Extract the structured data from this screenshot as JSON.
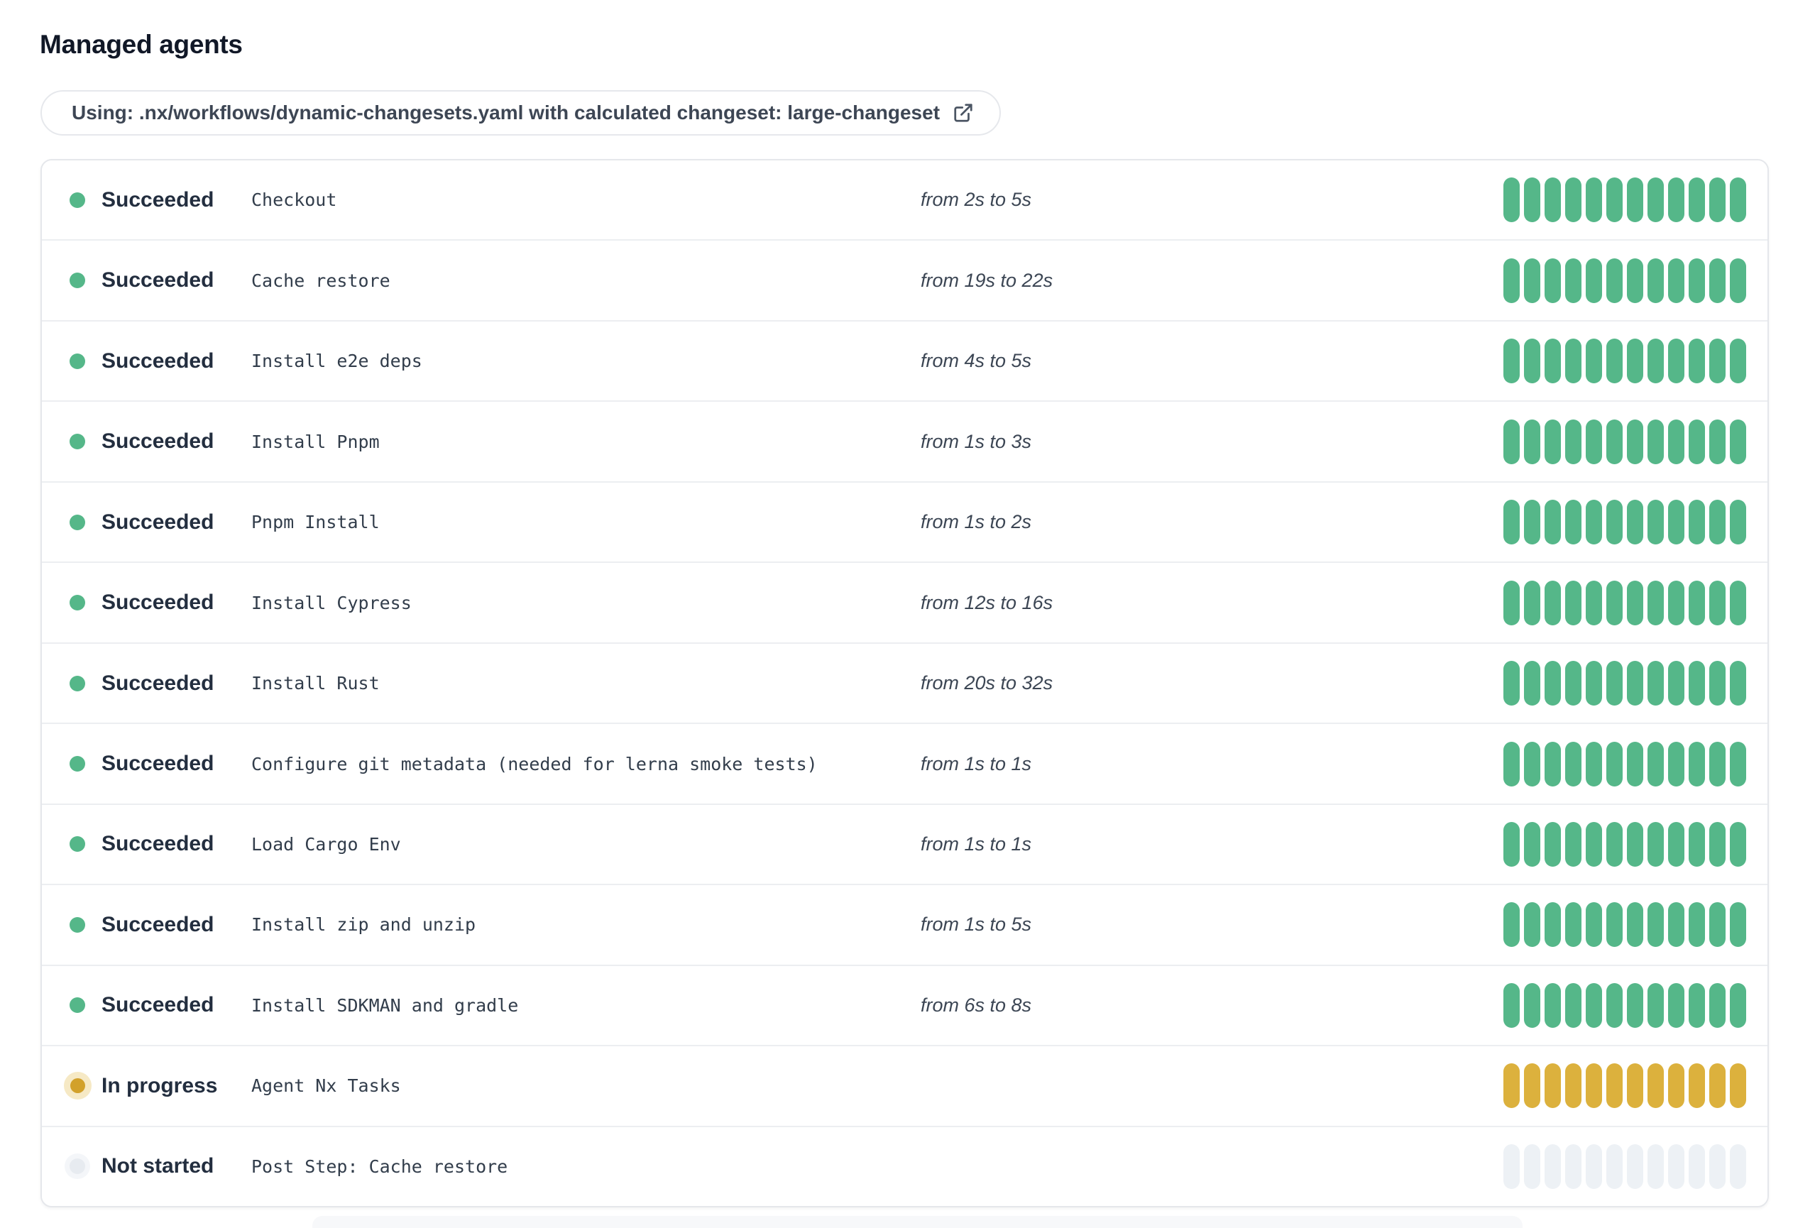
{
  "page": {
    "title": "Managed agents"
  },
  "banner": {
    "label": "Using: .nx/workflows/dynamic-changesets.yaml with calculated changeset: large-changeset",
    "icon": "external-link-icon"
  },
  "bar": {
    "segments_per_row": 12
  },
  "colors": {
    "succeeded_segment": "#55b789",
    "in_progress_segment": "#dcb13d",
    "not_started_segment": "#edf1f5",
    "succeeded_dot": "#55b789",
    "in_progress_dot": "#d2a12b",
    "in_progress_halo": "#f6e9c5",
    "not_started_dot": "#e7ebf0"
  },
  "rows": [
    {
      "status": "succeeded",
      "status_label": "Succeeded",
      "name": "Checkout",
      "duration": "from 2s to 5s"
    },
    {
      "status": "succeeded",
      "status_label": "Succeeded",
      "name": "Cache restore",
      "duration": "from 19s to 22s"
    },
    {
      "status": "succeeded",
      "status_label": "Succeeded",
      "name": "Install e2e deps",
      "duration": "from 4s to 5s"
    },
    {
      "status": "succeeded",
      "status_label": "Succeeded",
      "name": "Install Pnpm",
      "duration": "from 1s to 3s"
    },
    {
      "status": "succeeded",
      "status_label": "Succeeded",
      "name": "Pnpm Install",
      "duration": "from 1s to 2s"
    },
    {
      "status": "succeeded",
      "status_label": "Succeeded",
      "name": "Install Cypress",
      "duration": "from 12s to 16s"
    },
    {
      "status": "succeeded",
      "status_label": "Succeeded",
      "name": "Install Rust",
      "duration": "from 20s to 32s"
    },
    {
      "status": "succeeded",
      "status_label": "Succeeded",
      "name": "Configure git metadata (needed for lerna smoke tests)",
      "duration": "from 1s to 1s"
    },
    {
      "status": "succeeded",
      "status_label": "Succeeded",
      "name": "Load Cargo Env",
      "duration": "from 1s to 1s"
    },
    {
      "status": "succeeded",
      "status_label": "Succeeded",
      "name": "Install zip and unzip",
      "duration": "from 1s to 5s"
    },
    {
      "status": "succeeded",
      "status_label": "Succeeded",
      "name": "Install SDKMAN and gradle",
      "duration": "from 6s to 8s"
    },
    {
      "status": "in-progress",
      "status_label": "In progress",
      "name": "Agent Nx Tasks",
      "duration": ""
    },
    {
      "status": "not-started",
      "status_label": "Not started",
      "name": "Post Step: Cache restore",
      "duration": ""
    }
  ]
}
